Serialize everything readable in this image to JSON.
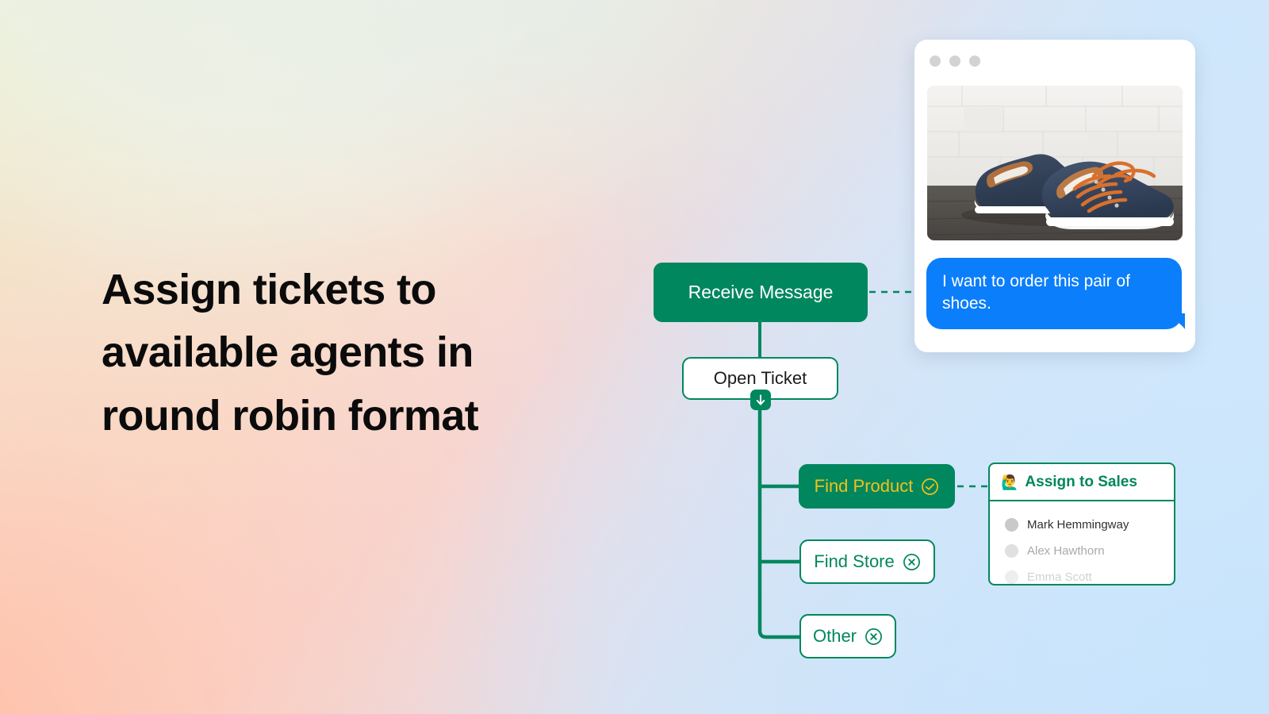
{
  "headline": "Assign tickets to available agents in round robin format",
  "theme": {
    "green": "#01875e",
    "yellow": "#f2c019",
    "chat_blue": "#0b7efb",
    "panel_border": "#01875e",
    "white": "#ffffff"
  },
  "flow": {
    "nodes": [
      {
        "id": "receive-message",
        "label": "Receive Message",
        "style": "filled-green",
        "icon": null
      },
      {
        "id": "open-ticket",
        "label": "Open Ticket",
        "style": "outline",
        "icon": "arrow-down-icon"
      },
      {
        "id": "find-product",
        "label": "Find Product",
        "style": "filled-green-yellow-text",
        "icon": "check-circle-icon"
      },
      {
        "id": "find-store",
        "label": "Find Store",
        "style": "outline",
        "icon": "x-circle-icon"
      },
      {
        "id": "other",
        "label": "Other",
        "style": "outline",
        "icon": "x-circle-icon"
      }
    ],
    "connectors": [
      {
        "from": "receive-message",
        "to": "open-ticket",
        "style": "solid"
      },
      {
        "from": "open-ticket",
        "to": "find-product",
        "style": "solid"
      },
      {
        "from": "open-ticket",
        "to": "find-store",
        "style": "solid"
      },
      {
        "from": "open-ticket",
        "to": "other",
        "style": "solid"
      },
      {
        "from": "receive-message",
        "to": "chat-window",
        "style": "dashed"
      },
      {
        "from": "find-product",
        "to": "assign-panel",
        "style": "dashed"
      }
    ]
  },
  "chat": {
    "window_dots": 3,
    "product_image_alt": "navy canvas sneakers with orange laces",
    "message": "I want to order this pair of shoes."
  },
  "assign_panel": {
    "emoji": "🙋‍♂️",
    "title": "Assign to Sales",
    "agents": [
      {
        "name": "Mark Hemmingway",
        "state": "active"
      },
      {
        "name": "Alex Hawthorn",
        "state": "dimmed"
      },
      {
        "name": "Emma Scott",
        "state": "faded"
      }
    ]
  }
}
